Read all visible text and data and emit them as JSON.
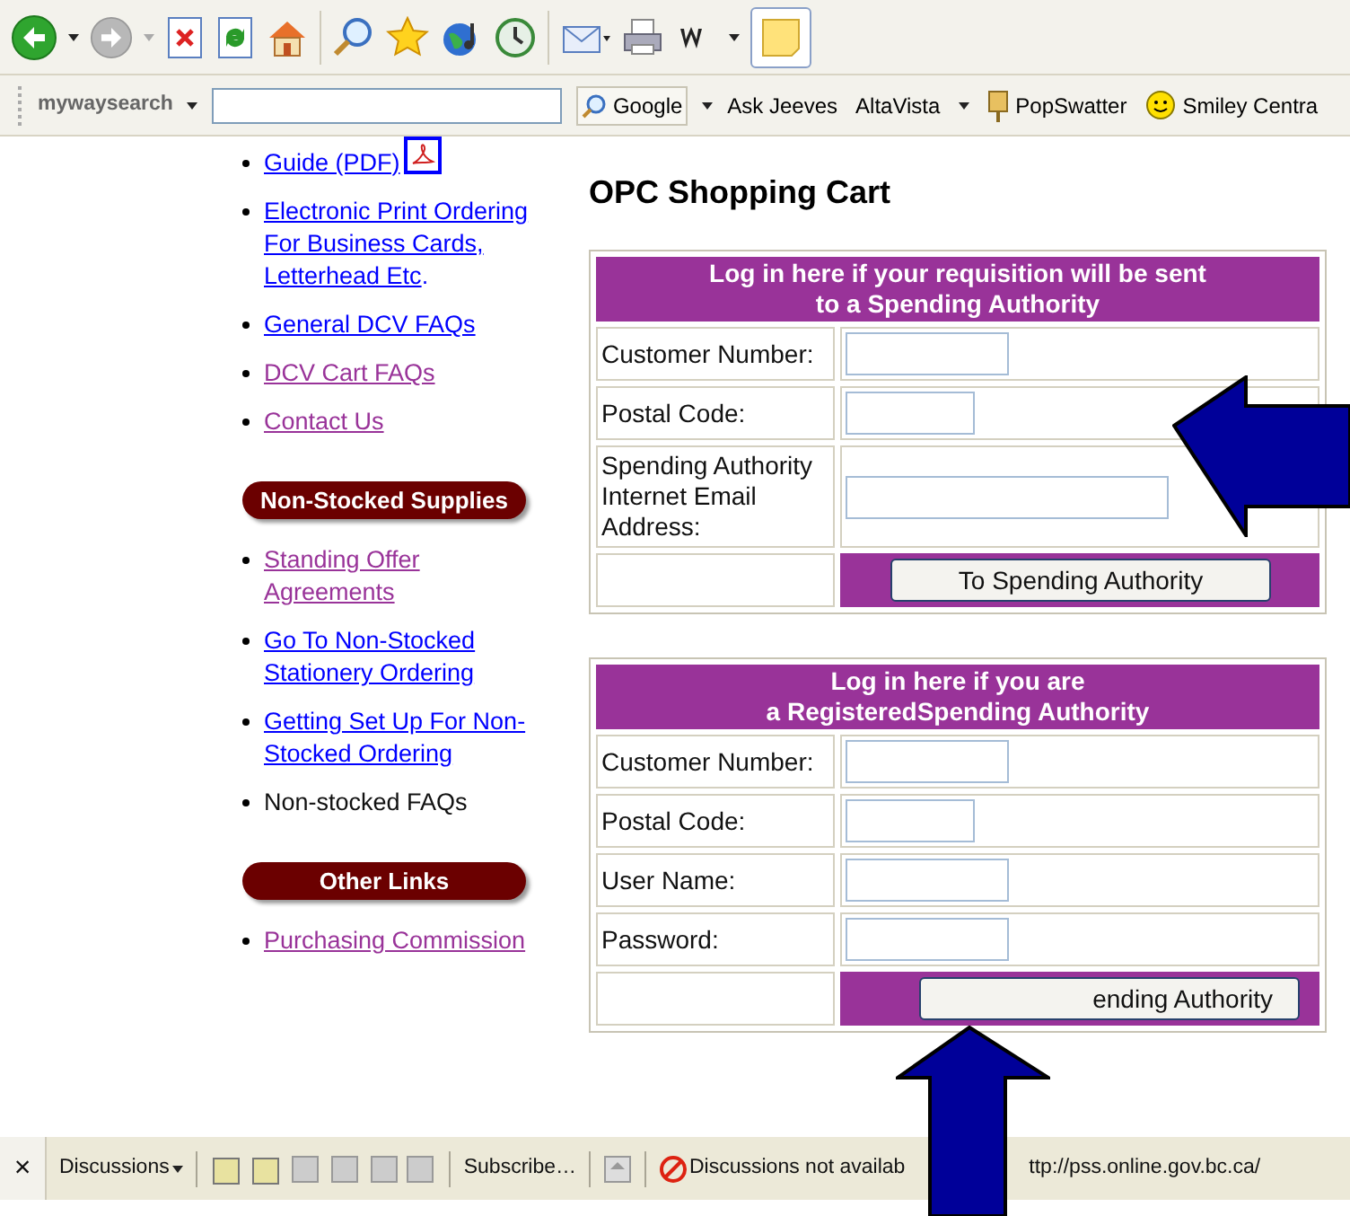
{
  "search_bar": {
    "logo": "my**way**search",
    "search_button": "Google",
    "links": [
      {
        "label": "Ask Jeeves",
        "kind": "plain"
      },
      {
        "label": "AltaVista",
        "kind": "menu"
      },
      {
        "label": "PopSwatter",
        "kind": "popswatter"
      },
      {
        "label": "Smiley Centra",
        "kind": "smiley"
      }
    ]
  },
  "sidebar": {
    "sections": [
      {
        "items": [
          {
            "kind": "link",
            "label": "Guide (PDF)",
            "visited": false,
            "pdf": true
          },
          {
            "kind": "link",
            "label": "Electronic Print Ordering For Business Cards, Letterhead Etc",
            "suffix": ".",
            "visited": false
          },
          {
            "kind": "link",
            "label": "General DCV FAQs",
            "visited": false
          },
          {
            "kind": "link",
            "label": "DCV Cart FAQs",
            "visited": true
          },
          {
            "kind": "link",
            "label": "Contact Us",
            "visited": true
          }
        ]
      },
      {
        "heading": "Non-Stocked Supplies",
        "items": [
          {
            "kind": "link",
            "label": "Standing Offer Agreements",
            "visited": true
          },
          {
            "kind": "link",
            "label": "Go To Non-Stocked Stationery Ordering",
            "visited": false
          },
          {
            "kind": "link",
            "label": "Getting Set Up For Non-Stocked Ordering",
            "visited": false
          },
          {
            "kind": "text",
            "label": "Non-stocked FAQs"
          }
        ]
      },
      {
        "heading": "Other Links",
        "items": [
          {
            "kind": "link",
            "label": "Purchasing Commission",
            "visited": true
          }
        ]
      }
    ]
  },
  "main": {
    "title": "OPC Shopping Cart",
    "forms": [
      {
        "header": [
          "Log in here if your requisition will be sent",
          "to a Spending Authority"
        ],
        "fields": [
          {
            "label": "Customer Number:",
            "kind": "medium"
          },
          {
            "label": "Postal Code:",
            "kind": "short"
          },
          {
            "label": "Spending Authority Internet Email Address:",
            "kind": "wide"
          }
        ],
        "button": "To Spending Authority"
      },
      {
        "header": [
          "Log in here if you are",
          "a RegisteredSpending Authority"
        ],
        "fields": [
          {
            "label": "Customer Number:",
            "kind": "medium"
          },
          {
            "label": "Postal Code:",
            "kind": "short"
          },
          {
            "label": "User Name:",
            "kind": "medium"
          },
          {
            "label": "Password:",
            "kind": "medium"
          }
        ],
        "button": "ending Authority"
      }
    ]
  },
  "status_bar": {
    "close": "×",
    "menu": "Discussions",
    "subscribe": "Subscribe…",
    "notice": "Discussions not availab",
    "url": "ttp://pss.online.gov.bc.ca/"
  }
}
